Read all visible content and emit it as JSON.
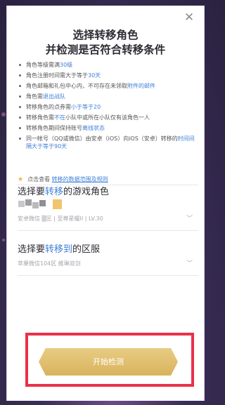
{
  "dialog": {
    "title_line1": "选择转移角色",
    "title_line2": "并检测是否符合转移条件",
    "close_icon": "close-icon"
  },
  "conditions": [
    {
      "pre": "角色等级需满",
      "hl": "30级",
      "post": ""
    },
    {
      "pre": "角色注册时间需大于等于",
      "hl": "30天",
      "post": ""
    },
    {
      "pre": "角色邮箱和礼包中心内，不可存在未领取",
      "hl": "附件的邮件",
      "post": ""
    },
    {
      "pre": "角色需",
      "hl": "退出战队",
      "post": ""
    },
    {
      "pre": "转移角色的点券需",
      "hl": "小于等于20",
      "post": ""
    },
    {
      "pre": "转移角色需",
      "hl": "不在",
      "post": "小队中或所在小队仅有该角色一人"
    },
    {
      "pre": "转移角色期间保持账号",
      "hl": "离线状态",
      "post": ""
    },
    {
      "pre": "同一帐号（QQ或微信）由安卓（iOS）向iOS（安卓）转移的",
      "hl": "时间间隔大于等于90天",
      "post": ""
    }
  ],
  "tip": {
    "prefix": "点击查看",
    "link": "转移的数据范围及规则",
    "star_icon": "star-icon"
  },
  "role_section": {
    "title_pre": "选择要",
    "title_hl": "转移",
    "title_post": "的游戏角色",
    "selected_text": "安卓微信  ▒区  |  至尊星耀II  |  LV.30"
  },
  "server_section": {
    "title_pre": "选择要",
    "title_hl": "转移到",
    "title_post": "的区服",
    "selected_text": "苹果微信104区  維琳双剑"
  },
  "button": {
    "label": "开始检测"
  },
  "colors": {
    "accent_blue": "#3d7fd7",
    "button_gold": "#d9b35c",
    "highlight_red": "#e83249"
  }
}
